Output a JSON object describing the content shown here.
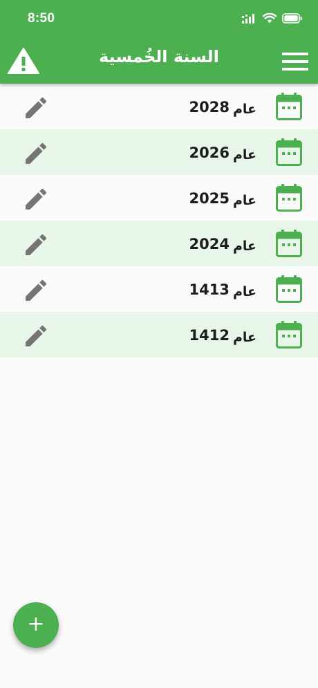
{
  "status_bar": {
    "time": "8:50",
    "icons": [
      "signal-icon",
      "wifi-icon",
      "battery-icon"
    ]
  },
  "app_bar": {
    "title": "السنة الخُمسية",
    "left_icon": "warning-icon",
    "right_icon": "menu-icon"
  },
  "rows": [
    {
      "prefix": "عام",
      "year": "2028"
    },
    {
      "prefix": "عام",
      "year": "2026"
    },
    {
      "prefix": "عام",
      "year": "2025"
    },
    {
      "prefix": "عام",
      "year": "2024"
    },
    {
      "prefix": "عام",
      "year": "1413"
    },
    {
      "prefix": "عام",
      "year": "1412"
    }
  ],
  "fab": {
    "label": "+"
  },
  "colors": {
    "primary": "#4caf50",
    "row_alt": "#e8f5e9",
    "background": "#fafafa",
    "edit_icon": "#757575",
    "text": "#1c1c1c"
  }
}
